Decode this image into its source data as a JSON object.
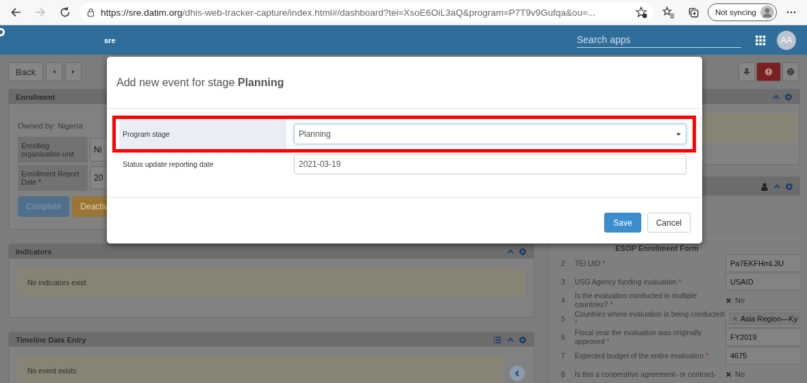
{
  "browser": {
    "url_host": "https://sre.datim.org",
    "url_path": "/dhis-web-tracker-capture/index.html#/dashboard?tei=XsoE6OiL3aQ&program=P7T9v9Gufqa&ou=...",
    "sync_label": "Not syncing"
  },
  "header": {
    "title": "sre",
    "search_placeholder": "Search apps",
    "avatar": "AA"
  },
  "toolbar": {
    "back": "Back"
  },
  "enrollment": {
    "title": "Enrollment",
    "owner": "Owned by: Nigeria",
    "fields": [
      {
        "label": "Enrolling organisation unit",
        "value": "Ni"
      },
      {
        "label": "Enrollment Report Date *",
        "value": "20"
      }
    ],
    "buttons": [
      {
        "label": "Complete",
        "kind": "primary"
      },
      {
        "label": "Deactiv",
        "kind": "warning"
      }
    ]
  },
  "indicators": {
    "title": "Indicators",
    "message": "No indicators exist"
  },
  "timeline": {
    "title": "Timeline Data Entry",
    "message": "No event exists"
  },
  "profile_form": {
    "title": "ESOP Enrollment Form",
    "rows": [
      {
        "number": "2",
        "label": "TEI UID",
        "mark": "*",
        "kind": "text",
        "value": "Pa7EKFHmL3U"
      },
      {
        "number": "3",
        "label": "USG Agency funding evaluation",
        "mark": "*",
        "kind": "text",
        "value": "USAID"
      },
      {
        "number": "4",
        "label": "Is the evaluation conducted in multiple countries?",
        "mark": "*",
        "kind": "boolean",
        "value": "No"
      },
      {
        "number": "5",
        "label": "Countries where evaluation is being conducted",
        "mark": "*",
        "kind": "multi",
        "value": "Asia Region—Ky"
      },
      {
        "number": "6",
        "label": "Fiscal year the evaluation was originally approved",
        "mark": "*",
        "kind": "text",
        "value": "FY2019"
      },
      {
        "number": "7",
        "label": "Expected budget of the entire evaluation",
        "mark": "*",
        "kind": "text",
        "value": "4675"
      },
      {
        "number": "8",
        "label": "Is this a cooperative agreement- or contract-",
        "kind": "boolean",
        "value": "No"
      }
    ]
  },
  "modal": {
    "title": "Add new event for stage **Planning**",
    "fields": [
      {
        "label": "Program stage",
        "kind": "select",
        "value": "Planning",
        "focused": true,
        "annotated": true
      },
      {
        "label": "Status update reporting date",
        "kind": "date",
        "value": "2021-03-19",
        "focused": false,
        "annotated": false
      }
    ],
    "buttons": [
      {
        "label": "Save",
        "kind": "primary"
      },
      {
        "label": "Cancel",
        "kind": "default"
      }
    ]
  }
}
